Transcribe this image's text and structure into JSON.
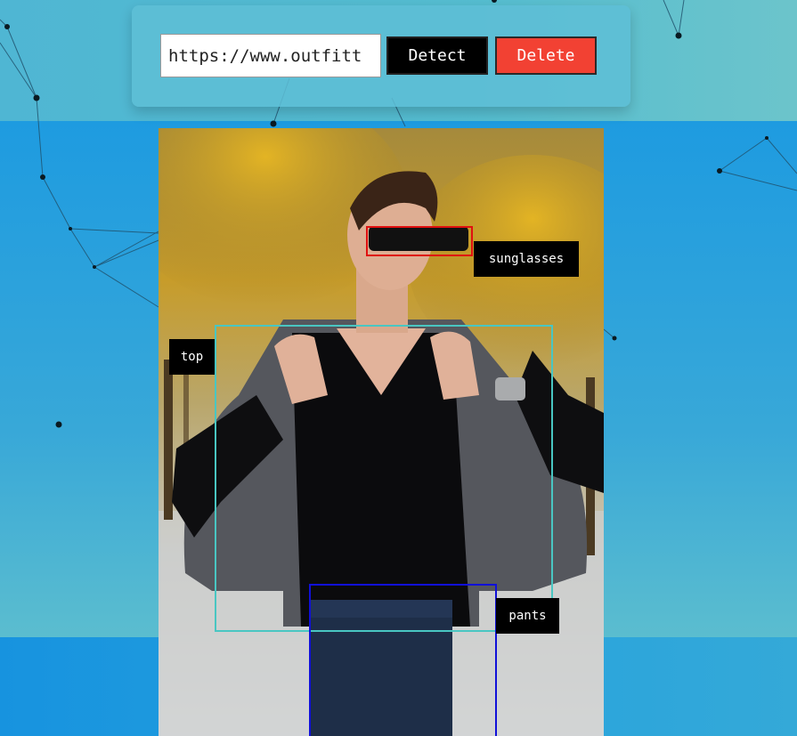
{
  "url_input": {
    "value": "https://www.outfitt"
  },
  "buttons": {
    "detect": "Detect",
    "delete": "Delete"
  },
  "detections": [
    {
      "label": "sunglasses",
      "color": "#e01010"
    },
    {
      "label": "top",
      "color": "#49c6c2"
    },
    {
      "label": "pants",
      "color": "#1010d8"
    }
  ]
}
